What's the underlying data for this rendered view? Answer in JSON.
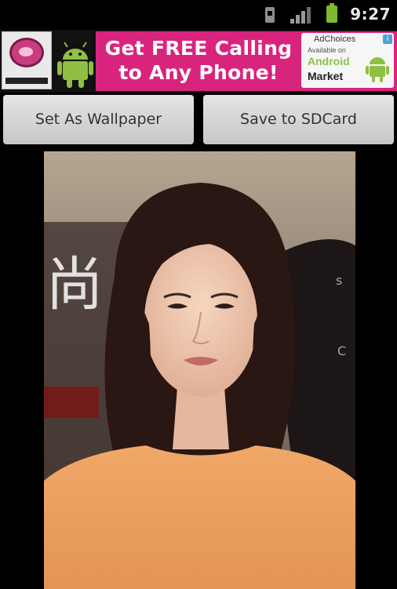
{
  "status_bar": {
    "time": "9:27",
    "icons": [
      "sim-icon",
      "signal-icon",
      "battery-icon"
    ],
    "battery_color": "#7dba2e"
  },
  "ad_banner": {
    "headline_line1": "Get FREE Calling",
    "headline_line2": "to Any Phone!",
    "adchoices": "AdChoices",
    "available_on": "Available on",
    "android": "Android",
    "market": "Market",
    "banner_color": "#d9247e",
    "icons": [
      "app-logo-icon",
      "android-robot-icon",
      "adchoices-info-icon"
    ]
  },
  "buttons": {
    "set_wallpaper": "Set As Wallpaper",
    "save_sdcard": "Save to SDCard"
  },
  "wallpaper_image": {
    "sign_glyph": "尚"
  }
}
